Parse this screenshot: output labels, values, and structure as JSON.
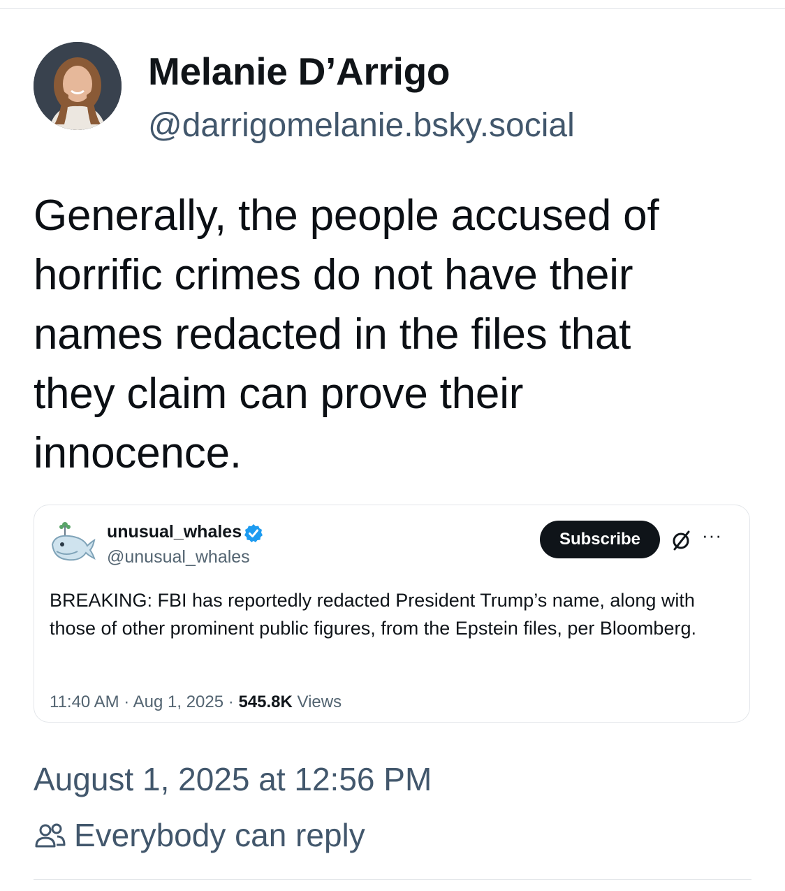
{
  "author": {
    "name": "Melanie D’Arrigo",
    "handle": "@darrigomelanie.bsky.social",
    "avatar_icon": "profile-photo"
  },
  "post": {
    "lines": [
      "Generally, the people accused of",
      "horrific crimes do not have their",
      "names redacted in the files that",
      "they claim can prove their",
      "innocence."
    ]
  },
  "embed": {
    "name": "unusual_whales",
    "handle": "@unusual_whales",
    "verified_icon": "verified-badge-icon",
    "subscribe_label": "Subscribe",
    "grok_icon": "slashed-circle-icon",
    "more_label": "···",
    "text": "BREAKING: FBI has reportedly redacted President Trump’s name, along with those of other prominent public figures, from the Epstein files, per Bloomberg.",
    "time": "11:40 AM",
    "date": "Aug 1, 2025",
    "views_count": "545.8K",
    "views_label": "Views"
  },
  "footer": {
    "date": "August 1, 2025 at 12:56 PM",
    "reply_setting": "Everybody can reply",
    "reply_icon": "people-icon"
  },
  "colors": {
    "text_primary": "#0b0f14",
    "text_secondary": "#42576c",
    "embed_secondary": "#536471",
    "verified_blue": "#1d9bf0",
    "button_dark": "#0f1419"
  }
}
